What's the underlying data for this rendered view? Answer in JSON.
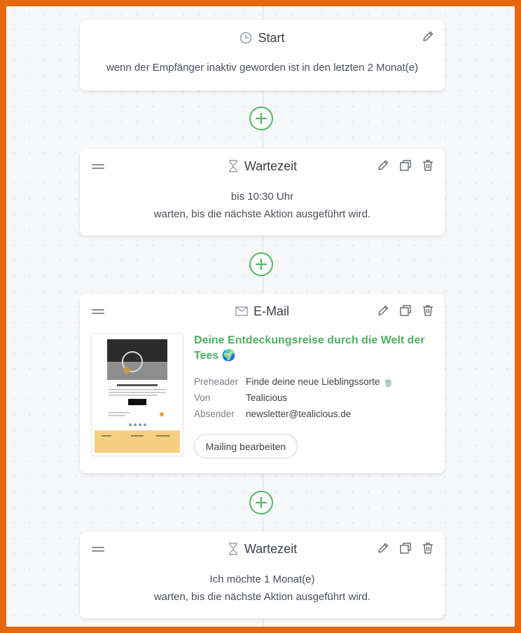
{
  "start": {
    "title": "Start",
    "icon": "clock-icon",
    "description": "wenn der Empfänger inaktiv geworden ist in den letzten 2 Monat(e)"
  },
  "wait1": {
    "title": "Wartezeit",
    "icon": "hourglass-icon",
    "line1": "bis 10:30 Uhr",
    "line2": "warten, bis die nächste Aktion ausgeführt wird."
  },
  "email": {
    "title": "E-Mail",
    "icon": "mail-icon",
    "subject": "Deine Entdeckungsreise durch die Welt der Tees 🌍",
    "preheader_label": "Preheader",
    "preheader_value": "Finde deine neue Lieblingssorte 🍵",
    "from_label": "Von",
    "from_value": "Tealicious",
    "sender_label": "Absender",
    "sender_value": "newsletter@tealicious.de",
    "edit_button": "Mailing bearbeiten"
  },
  "wait2": {
    "title": "Wartezeit",
    "icon": "hourglass-icon",
    "line1": "Ich möchte 1 Monat(e)",
    "line2": "warten, bis die nächste Aktion ausgeführt wird."
  },
  "colors": {
    "frame": "#E8680F",
    "accent_green": "#4fb863",
    "text": "#4a4f55"
  }
}
